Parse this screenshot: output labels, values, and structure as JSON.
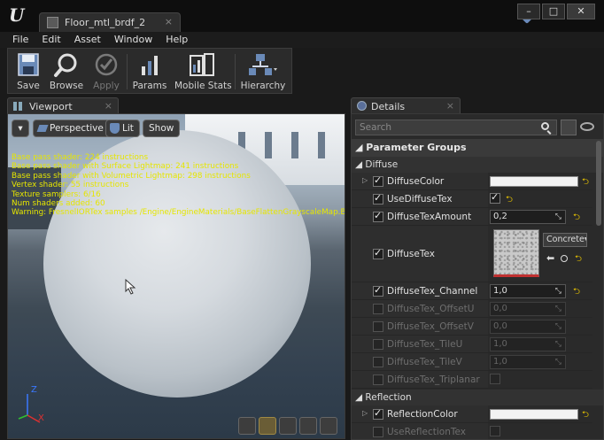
{
  "window": {
    "logo": "U",
    "tab_title": "Floor_mtl_brdf_2",
    "tab_close": "×",
    "minimize": "–",
    "maximize": "□",
    "close": "✕"
  },
  "menu": [
    "File",
    "Edit",
    "Asset",
    "Window",
    "Help"
  ],
  "toolbar": {
    "save": "Save",
    "browse": "Browse",
    "apply": "Apply",
    "params": "Params",
    "mobile_stats": "Mobile Stats",
    "hierarchy": "Hierarchy"
  },
  "viewport": {
    "tab_label": "Viewport",
    "tab_close": "×",
    "dropdown": "▾",
    "perspective": "Perspective",
    "lit": "Lit",
    "show": "Show",
    "stats": [
      "Base pass shader: 224 instructions",
      "Base pass shader with Surface Lightmap: 241 instructions",
      "Base pass shader with Volumetric Lightmap: 298 instructions",
      "Vertex shader: 55 instructions",
      "Texture samplers: 6/16",
      "Num shaders added: 60",
      "Warning: FresnelIORTex samples /Engine/EngineMaterials/BaseFlattenGrayscaleMap.Base"
    ],
    "axis_x": "X",
    "axis_z": "Z"
  },
  "details": {
    "tab_label": "Details",
    "tab_close": "×",
    "search_placeholder": "Search",
    "section": "Parameter Groups",
    "diffuse_header": "Diffuse",
    "reflection_header": "Reflection",
    "texture_dropdown": "Concrete",
    "rows": [
      {
        "name": "DiffuseColor"
      },
      {
        "name": "UseDiffuseTex"
      },
      {
        "name": "DiffuseTexAmount",
        "value": "0,2"
      },
      {
        "name": "DiffuseTex"
      },
      {
        "name": "DiffuseTex_Channel",
        "value": "1,0"
      },
      {
        "name": "DiffuseTex_OffsetU",
        "value": "0,0"
      },
      {
        "name": "DiffuseTex_OffsetV",
        "value": "0,0"
      },
      {
        "name": "DiffuseTex_TileU",
        "value": "1,0"
      },
      {
        "name": "DiffuseTex_TileV",
        "value": "1,0"
      },
      {
        "name": "DiffuseTex_Triplanar"
      },
      {
        "name": "ReflectionColor"
      },
      {
        "name": "UseReflectionTex"
      }
    ]
  },
  "colors": {
    "stats_text": "#e6e600",
    "reset_arrow": "#e6c200",
    "texture_underline": "#c03030"
  }
}
